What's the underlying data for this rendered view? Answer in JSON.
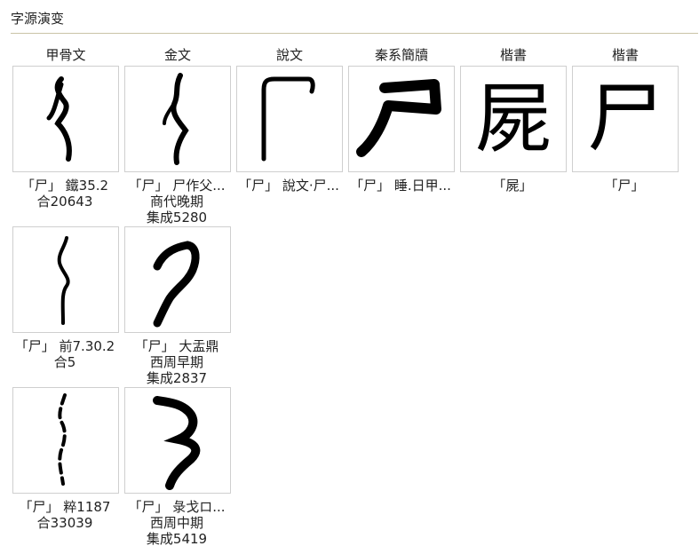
{
  "section": {
    "title": "字源演变"
  },
  "columns": [
    "甲骨文",
    "金文",
    "說文",
    "秦系簡牘",
    "楷書",
    "楷書"
  ],
  "glyphs": {
    "r0c0": {
      "line1": "「尸」 鐵35.2",
      "line2": "合20643"
    },
    "r0c1": {
      "line1": "「尸」 尸作父...",
      "line2": "商代晚期",
      "line3": "集成5280"
    },
    "r0c2": {
      "line1": "「尸」 說文‧尸..."
    },
    "r0c3": {
      "line1": "「尸」 睡.日甲..."
    },
    "r0c4": {
      "line1": "「屍」",
      "char": "屍"
    },
    "r0c5": {
      "line1": "「尸」",
      "char": "尸"
    },
    "r1c0": {
      "line1": "「尸」 前7.30.2",
      "line2": "合5"
    },
    "r1c1": {
      "line1": "「尸」 大盂鼎",
      "line2": "西周早期",
      "line3": "集成2837"
    },
    "r2c0": {
      "line1": "「尸」 粹1187",
      "line2": "合33039"
    },
    "r2c1": {
      "line1": "「尸」 彔戈ロ...",
      "line2": "西周中期",
      "line3": "集成5419"
    }
  }
}
